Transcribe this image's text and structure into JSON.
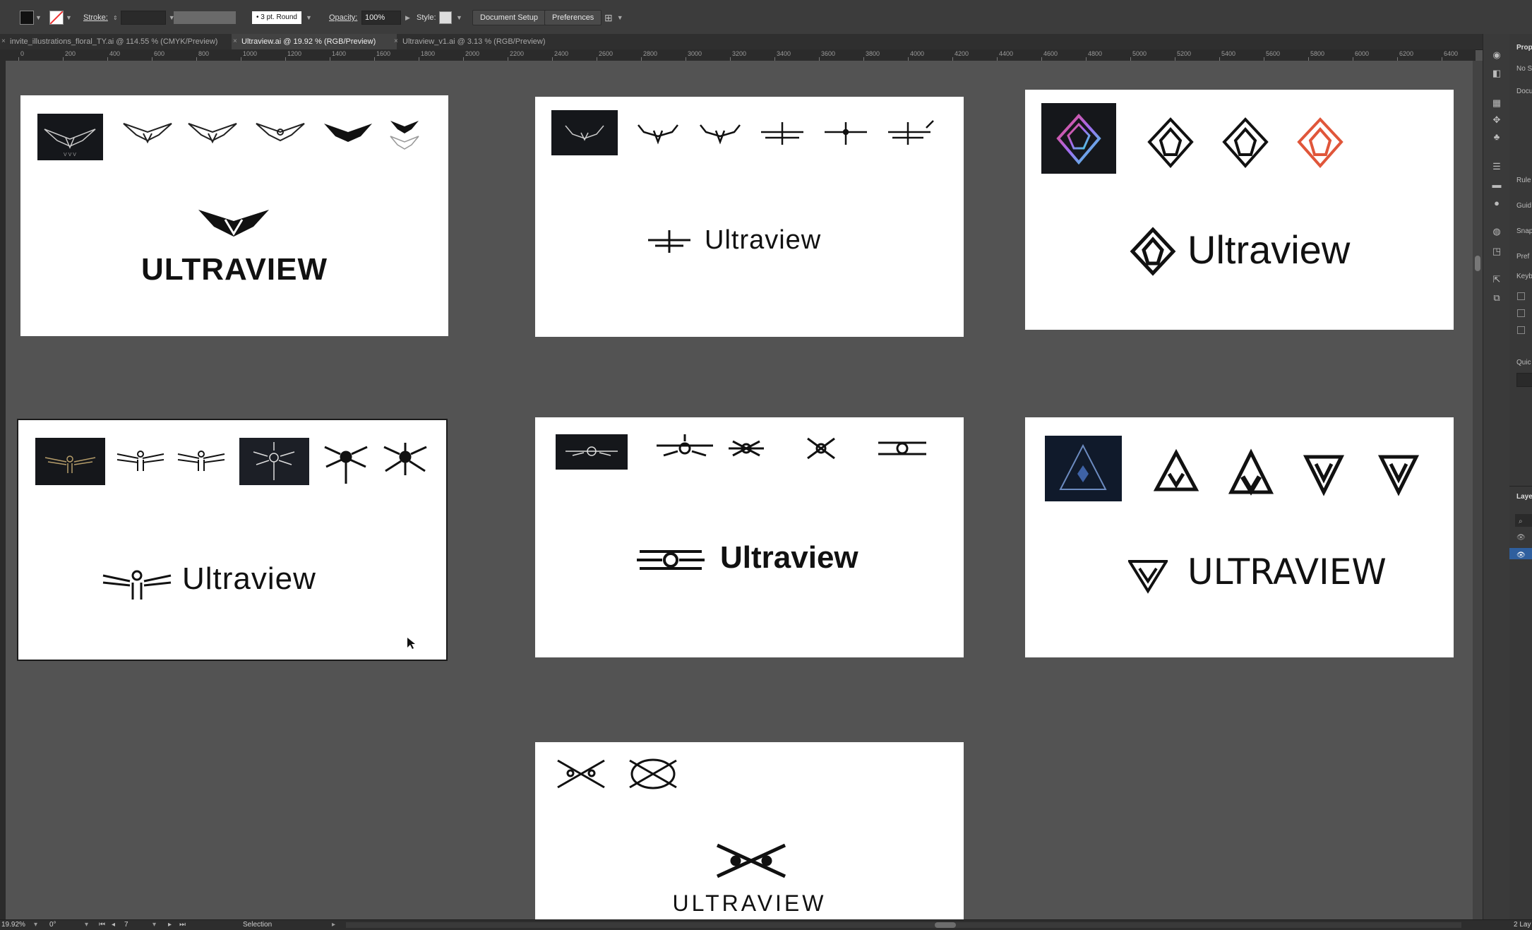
{
  "control_bar": {
    "stroke_label": "Stroke:",
    "brush_label": "3 pt. Round",
    "opacity_label": "Opacity:",
    "opacity_value": "100%",
    "style_label": "Style:",
    "document_setup": "Document Setup",
    "preferences": "Preferences"
  },
  "tabs": [
    {
      "label": "invite_illustrations_floral_TY.ai @ 114.55 % (CMYK/Preview)",
      "active": false
    },
    {
      "label": "Ultraview.ai @ 19.92 % (RGB/Preview)",
      "active": true
    },
    {
      "label": "Ultraview_v1.ai @ 3.13 % (RGB/Preview)",
      "active": false
    }
  ],
  "ruler_ticks": [
    "0",
    "200",
    "400",
    "600",
    "800",
    "1000",
    "1200",
    "1400",
    "1600",
    "1800",
    "2000",
    "2200",
    "2400",
    "2600",
    "2800",
    "3000",
    "3200",
    "3400",
    "3600",
    "3800",
    "4000",
    "4200",
    "4400",
    "4600",
    "4800",
    "5000",
    "5200",
    "5400",
    "5600",
    "5800",
    "6000",
    "6200",
    "6400"
  ],
  "artboards": {
    "a1": {
      "wordmark": "ULTRAVIEW"
    },
    "a2": {
      "wordmark": "Ultraview"
    },
    "a3": {
      "wordmark": "Ultraview"
    },
    "a4": {
      "wordmark": "Ultraview"
    },
    "a5": {
      "wordmark": "Ultraview"
    },
    "a6": {
      "wordmark": "ULTRAVIEW"
    },
    "a7": {
      "wordmark": "ULTRAVIEW"
    }
  },
  "right_panel_labels": [
    "Prop",
    "No S",
    "Docu",
    "Rule",
    "Guid",
    "Snap",
    "Pref",
    "Keyb",
    "Quic",
    "Laye"
  ],
  "status_bar": {
    "zoom": "19.92%",
    "rotation": "0°",
    "artboard_number": "7",
    "tool": "Selection",
    "layers_count": "2 Lay"
  },
  "colors": {
    "chrome": "#3c3c3c",
    "canvas": "#535353",
    "red_logo": "#e0563a",
    "dark_tile": "#15171b"
  }
}
